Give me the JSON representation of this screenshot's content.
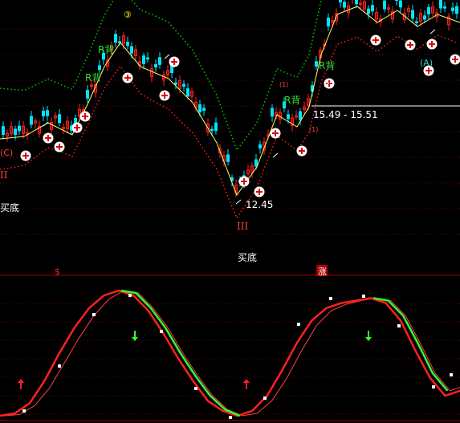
{
  "chart_data": [
    {
      "type": "candlestick",
      "panel": "price",
      "annotations": {
        "range_label": "15.49 - 15.51",
        "low_label": "12.45",
        "buy_bottom_labels": [
          "买底",
          "买底"
        ],
        "r_back_labels": [
          "R背",
          "R背",
          "R背",
          "R背"
        ],
        "roman_labels": [
          "II",
          "III"
        ],
        "circle_labels": [
          "(C)",
          "(A)",
          "③",
          "(1)",
          "(1)"
        ],
        "plus_marker_count": 17
      },
      "colors": {
        "up": "#ff2020",
        "down": "#00e5ff",
        "zigzag": "#ffff66",
        "band_upper": "#00cc00",
        "band_lower": "#ff2020",
        "support": "#ffffff"
      }
    },
    {
      "type": "line",
      "panel": "oscillator",
      "top_markers": [
        "$",
        "涨"
      ],
      "series": [
        {
          "color": "#ff2020",
          "values": [
            0,
            2,
            10,
            28,
            50,
            70,
            86,
            96,
            100,
            96,
            84,
            66,
            46,
            28,
            12,
            4,
            0,
            4,
            16,
            36,
            58,
            76,
            86,
            90,
            92,
            94,
            90,
            76,
            52,
            30,
            16,
            20
          ]
        },
        {
          "color": "#30ff30",
          "values": [
            0,
            1,
            8,
            22,
            42,
            62,
            80,
            93,
            100,
            98,
            86,
            70,
            50,
            32,
            16,
            5,
            0,
            2,
            12,
            30,
            52,
            72,
            84,
            89,
            92,
            94,
            92,
            80,
            58,
            34,
            20,
            24
          ]
        }
      ],
      "signal_arrows": [
        {
          "dir": "up",
          "color": "#ff2020"
        },
        {
          "dir": "down",
          "color": "#30ff30"
        },
        {
          "dir": "up",
          "color": "#ff2020"
        },
        {
          "dir": "down",
          "color": "#30ff30"
        }
      ]
    }
  ]
}
